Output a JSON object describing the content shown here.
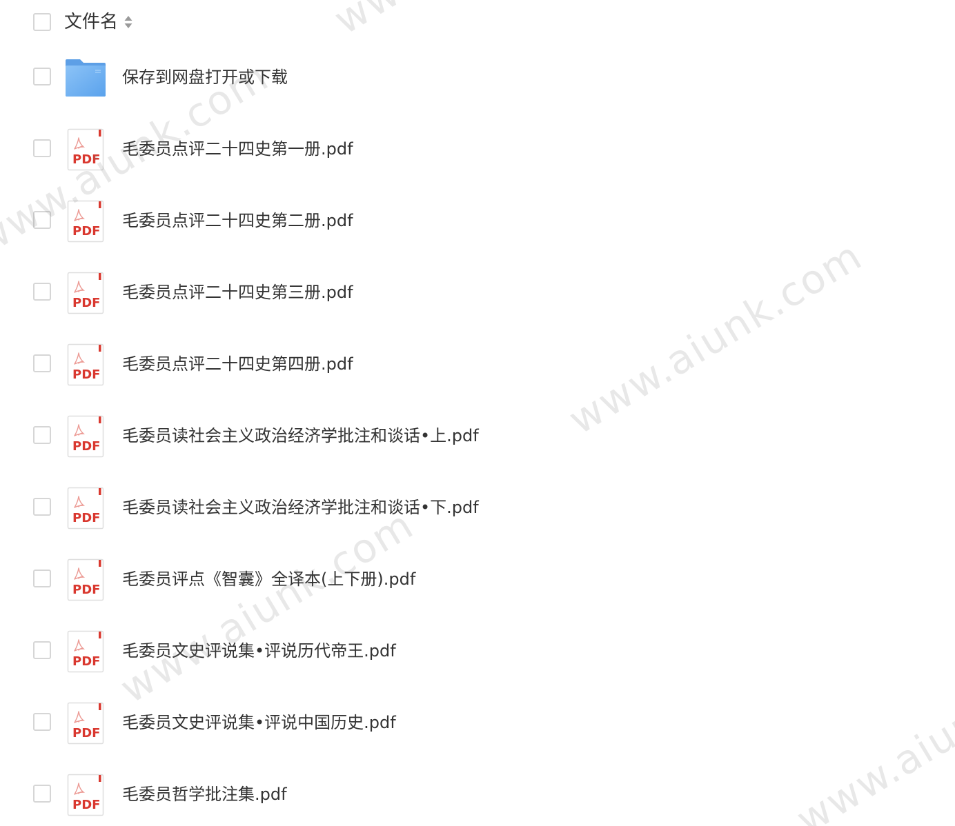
{
  "header": {
    "title": "文件名",
    "sort_icon": "sort-icon"
  },
  "files": [
    {
      "name": "保存到网盘打开或下载",
      "type": "folder",
      "icon": "folder-icon"
    },
    {
      "name": "毛委员点评二十四史第一册.pdf",
      "type": "pdf",
      "icon": "pdf-file-icon"
    },
    {
      "name": "毛委员点评二十四史第二册.pdf",
      "type": "pdf",
      "icon": "pdf-file-icon"
    },
    {
      "name": "毛委员点评二十四史第三册.pdf",
      "type": "pdf",
      "icon": "pdf-file-icon"
    },
    {
      "name": "毛委员点评二十四史第四册.pdf",
      "type": "pdf",
      "icon": "pdf-file-icon"
    },
    {
      "name": "毛委员读社会主义政治经济学批注和谈话•上.pdf",
      "type": "pdf",
      "icon": "pdf-file-icon"
    },
    {
      "name": "毛委员读社会主义政治经济学批注和谈话•下.pdf",
      "type": "pdf",
      "icon": "pdf-file-icon"
    },
    {
      "name": "毛委员评点《智囊》全译本(上下册).pdf",
      "type": "pdf",
      "icon": "pdf-file-icon"
    },
    {
      "name": "毛委员文史评说集•评说历代帝王.pdf",
      "type": "pdf",
      "icon": "pdf-file-icon"
    },
    {
      "name": "毛委员文史评说集•评说中国历史.pdf",
      "type": "pdf",
      "icon": "pdf-file-icon"
    },
    {
      "name": "毛委员哲学批注集.pdf",
      "type": "pdf",
      "icon": "pdf-file-icon"
    }
  ],
  "pdf_label": "PDF",
  "watermarks": [
    "www.aiunk.com",
    "www.aiunk.com",
    "www.aiunk.com",
    "www.aiunk.com",
    "www.aiunk.com"
  ],
  "colors": {
    "pdf_red": "#d9382f",
    "folder_blue": "#6aaef2",
    "text": "#333333",
    "checkbox_border": "#d6d6d6"
  }
}
